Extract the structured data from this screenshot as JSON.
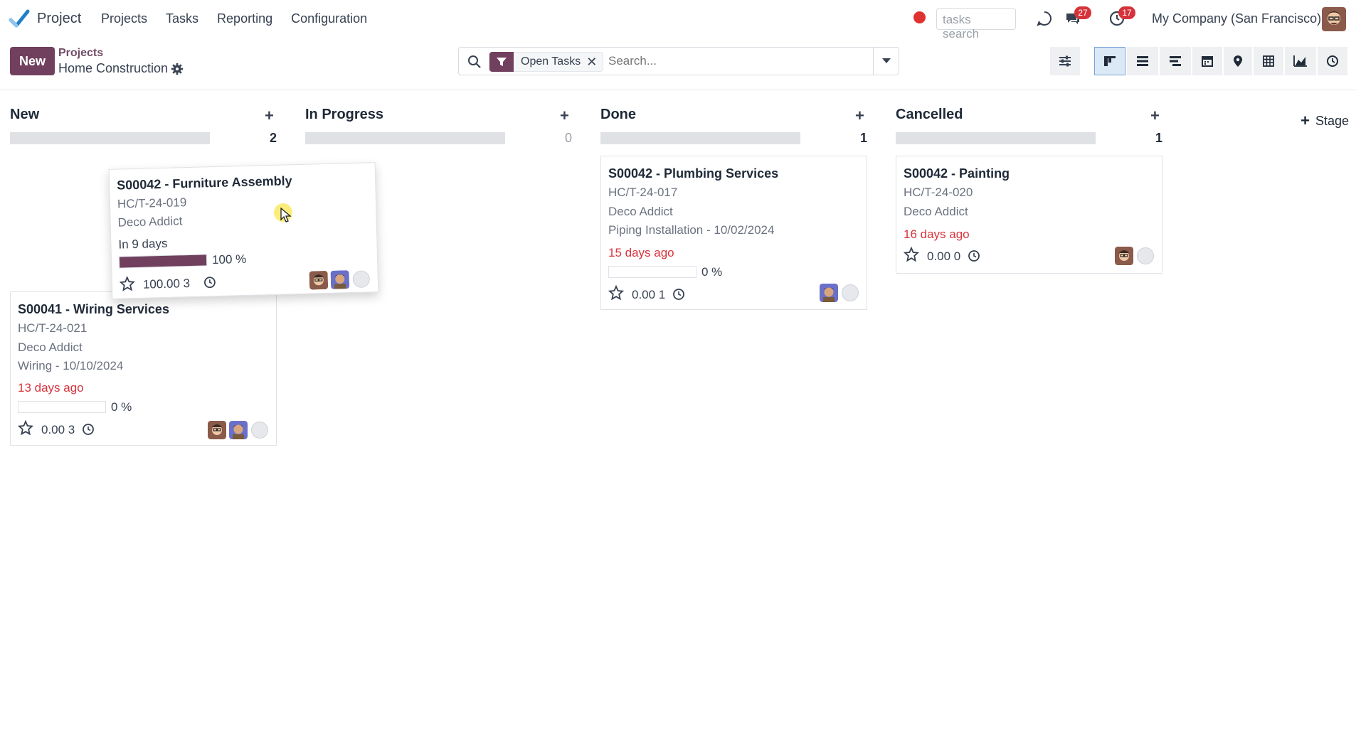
{
  "app": {
    "name": "Project"
  },
  "menu": [
    "Projects",
    "Tasks",
    "Reporting",
    "Configuration"
  ],
  "navbar": {
    "search_placeholder": "tasks search",
    "messages_badge": "27",
    "activities_badge": "17",
    "company": "My Company (San Francisco)"
  },
  "control": {
    "new_label": "New",
    "breadcrumb_parent": "Projects",
    "breadcrumb_current": "Home Construction",
    "facet_label": "Open Tasks",
    "facet_close": "✕",
    "search_placeholder": "Search..."
  },
  "views": [
    "kanban",
    "list",
    "gantt",
    "calendar",
    "map",
    "pivot",
    "graph",
    "activity"
  ],
  "active_view": "kanban",
  "colors": {
    "brand": "#71405f",
    "danger": "#d9323b",
    "link": "#714b67"
  },
  "stage_add_label": "Stage",
  "columns": [
    {
      "title": "New",
      "count": "2"
    },
    {
      "title": "In Progress",
      "count": "0"
    },
    {
      "title": "Done",
      "count": "1"
    },
    {
      "title": "Cancelled",
      "count": "1"
    }
  ],
  "cards": {
    "furniture": {
      "title": "S00042 - Furniture Assembly",
      "ref": "HC/T-24-019",
      "customer": "Deco Addict",
      "deadline": "In 9 days",
      "progress_label": "100 %",
      "progress": 1.0,
      "hours": "100.00 3"
    },
    "wiring": {
      "title": "S00041 - Wiring Services",
      "ref": "HC/T-24-021",
      "customer": "Deco Addict",
      "milestone": "Wiring - 10/10/2024",
      "deadline": "13 days ago",
      "progress_label": "0 %",
      "progress": 0,
      "hours": "0.00 3"
    },
    "plumbing": {
      "title": "S00042 - Plumbing Services",
      "ref": "HC/T-24-017",
      "customer": "Deco Addict",
      "milestone": "Piping Installation - 10/02/2024",
      "deadline": "15 days ago",
      "progress_label": "0 %",
      "progress": 0,
      "hours": "0.00 1"
    },
    "painting": {
      "title": "S00042 - Painting",
      "ref": "HC/T-24-020",
      "customer": "Deco Addict",
      "deadline": "16 days ago",
      "hours": "0.00 0"
    }
  }
}
